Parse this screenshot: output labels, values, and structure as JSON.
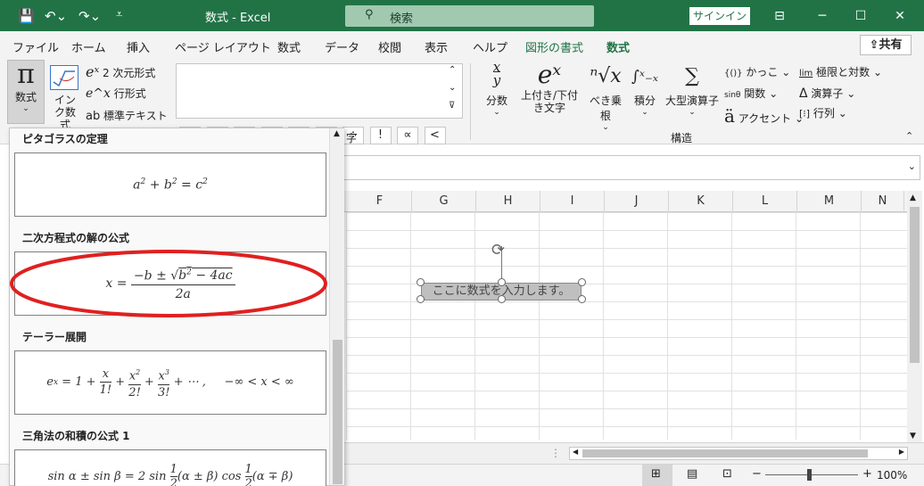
{
  "titlebar": {
    "title": "数式  -  Excel",
    "search_label": "検索",
    "signin_label": "サインイン",
    "window_controls": [
      "─",
      "☐",
      "✕"
    ]
  },
  "menubar": {
    "tabs": [
      "ファイル",
      "ホーム",
      "挿入",
      "ページ レイアウト",
      "数式",
      "データ",
      "校閲",
      "表示",
      "ヘルプ",
      "図形の書式",
      "数式"
    ],
    "share_label": "共有"
  },
  "ribbon": {
    "equation_btn": "数式",
    "ink_btn": "インク数式",
    "professional": "2 次元形式",
    "linear": "行形式",
    "normal_text": "標準テキスト",
    "symbols_row1": [
      "±",
      "∞",
      "=",
      "≠",
      "~",
      "×",
      "÷",
      "!",
      "∝",
      "<"
    ],
    "symbols_row2": [
      "≪",
      ">",
      "≫",
      "≤",
      "≥",
      "∓",
      "≅",
      "≈",
      "≡",
      "∀"
    ],
    "group_symbols_fragment": "字",
    "fraction": "分数",
    "script": "上付き/下付き文字",
    "radical": "べき乗根",
    "integral": "積分",
    "large_operator": "大型演算子",
    "bracket": "かっこ",
    "function": "関数",
    "accent": "アクセント",
    "limit": "極限と対数",
    "operator": "演算子",
    "matrix": "行列",
    "group_structures": "構造"
  },
  "gallery": {
    "items": [
      {
        "title": "ピタゴラスの定理"
      },
      {
        "title": "二次方程式の解の公式"
      },
      {
        "title": "テーラー展開"
      },
      {
        "title": "三角法の和積の公式 1"
      }
    ]
  },
  "sheet": {
    "columns": [
      "F",
      "G",
      "H",
      "I",
      "J",
      "K",
      "L",
      "M",
      "N"
    ],
    "equation_placeholder": "ここに数式を入力します。"
  },
  "status": {
    "zoom": "100%",
    "zoom_out": "−",
    "zoom_in": "+"
  },
  "colors": {
    "accent": "#217346",
    "annotation": "#e02020"
  }
}
